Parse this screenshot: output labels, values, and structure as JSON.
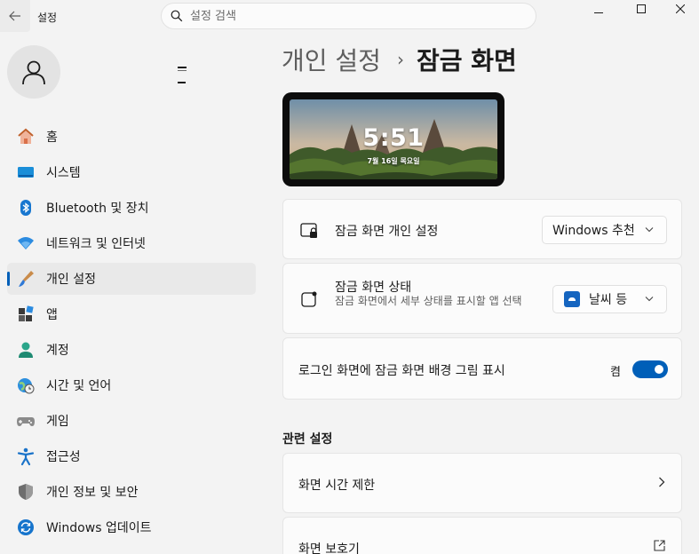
{
  "window": {
    "title": "설정"
  },
  "search": {
    "placeholder": "설정 검색"
  },
  "sidebar": {
    "items": [
      {
        "label": "홈",
        "icon": "home-icon"
      },
      {
        "label": "시스템",
        "icon": "system-icon"
      },
      {
        "label": "Bluetooth 및 장치",
        "icon": "bluetooth-icon"
      },
      {
        "label": "네트워크 및 인터넷",
        "icon": "wifi-icon"
      },
      {
        "label": "개인 설정",
        "icon": "brush-icon",
        "active": true
      },
      {
        "label": "앱",
        "icon": "apps-icon"
      },
      {
        "label": "계정",
        "icon": "account-icon"
      },
      {
        "label": "시간 및 언어",
        "icon": "globe-clock-icon"
      },
      {
        "label": "게임",
        "icon": "gamepad-icon"
      },
      {
        "label": "접근성",
        "icon": "accessibility-icon"
      },
      {
        "label": "개인 정보 및 보안",
        "icon": "shield-icon"
      },
      {
        "label": "Windows 업데이트",
        "icon": "update-icon"
      }
    ]
  },
  "breadcrumb": {
    "parent": "개인 설정",
    "separator": "›",
    "current": "잠금 화면"
  },
  "preview": {
    "time": "5:51",
    "date": "7월 16일 목요일"
  },
  "settings": {
    "personalize": {
      "title": "잠금 화면 개인 설정",
      "value": "Windows 추천"
    },
    "status": {
      "title": "잠금 화면 상태",
      "desc": "잠금 화면에서 세부 상태를 표시할 앱 선택",
      "value": "날씨 등"
    },
    "signin_bg": {
      "title": "로그인 화면에 잠금 화면 배경 그림 표시",
      "state_label": "켬",
      "on": true
    }
  },
  "related": {
    "title": "관련 설정",
    "items": [
      {
        "label": "화면 시간 제한"
      },
      {
        "label": "화면 보호기"
      }
    ]
  },
  "colors": {
    "accent": "#005fb8",
    "background": "#f3f3f3",
    "card": "#fbfbfb"
  }
}
